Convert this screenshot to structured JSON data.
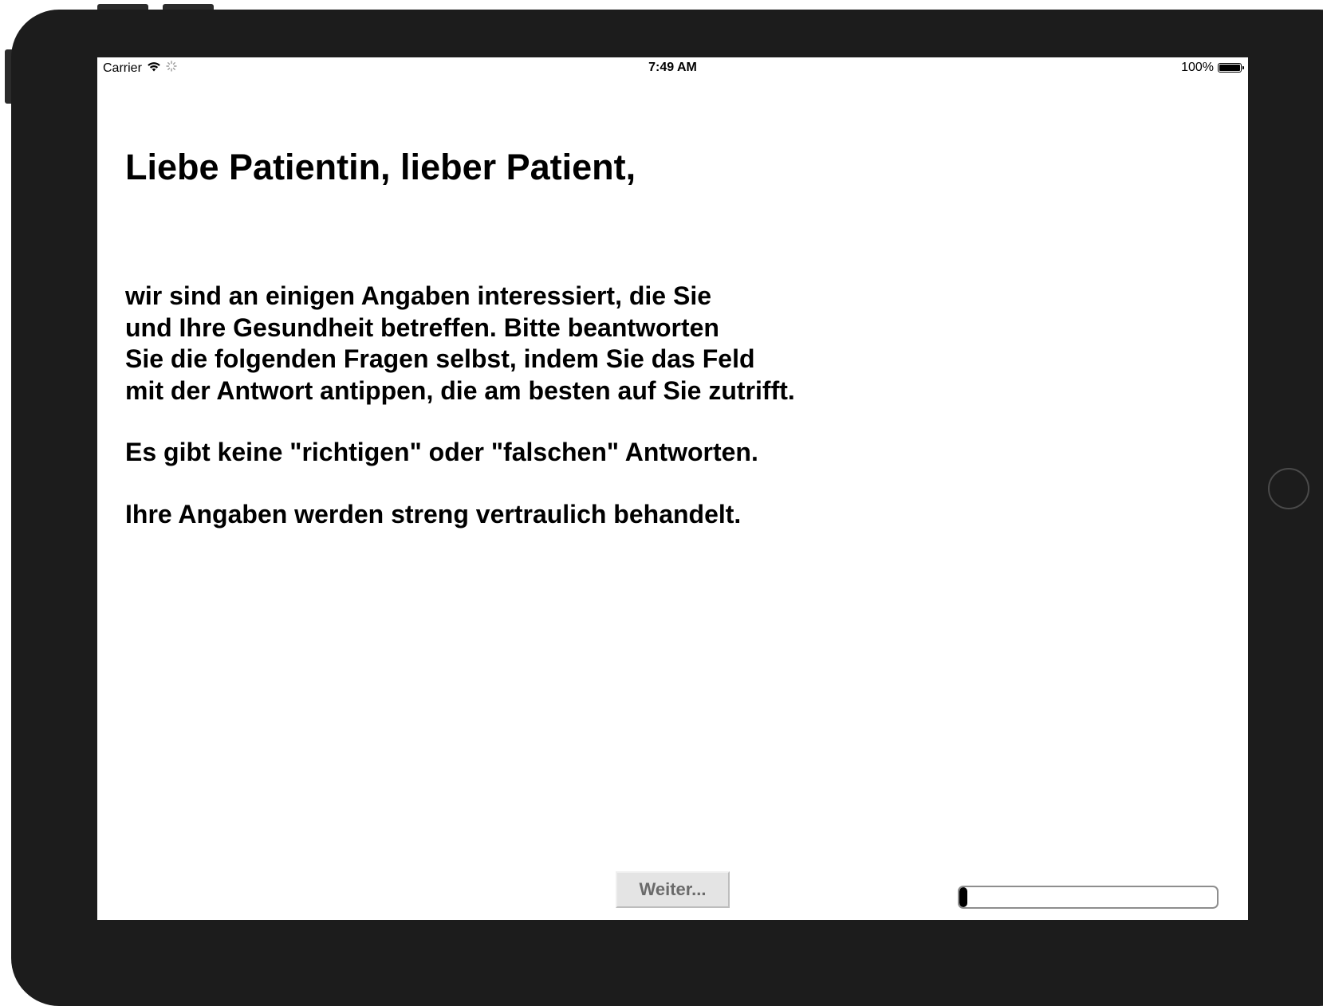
{
  "status_bar": {
    "carrier": "Carrier",
    "time": "7:49 AM",
    "battery": "100%"
  },
  "content": {
    "heading": "Liebe Patientin, lieber Patient,",
    "intro": "wir sind an einigen Angaben interessiert, die Sie\nund Ihre Gesundheit betreffen. Bitte beantworten\nSie die folgenden Fragen selbst, indem Sie das Feld\nmit der Antwort antippen, die am besten auf Sie zutrifft.",
    "no_right_wrong": "Es gibt keine \"richtigen\" oder \"falschen\" Antworten.",
    "confidential": "Ihre Angaben werden streng vertraulich behandelt."
  },
  "footer": {
    "next_button": "Weiter...",
    "progress_fraction": 0.03
  }
}
